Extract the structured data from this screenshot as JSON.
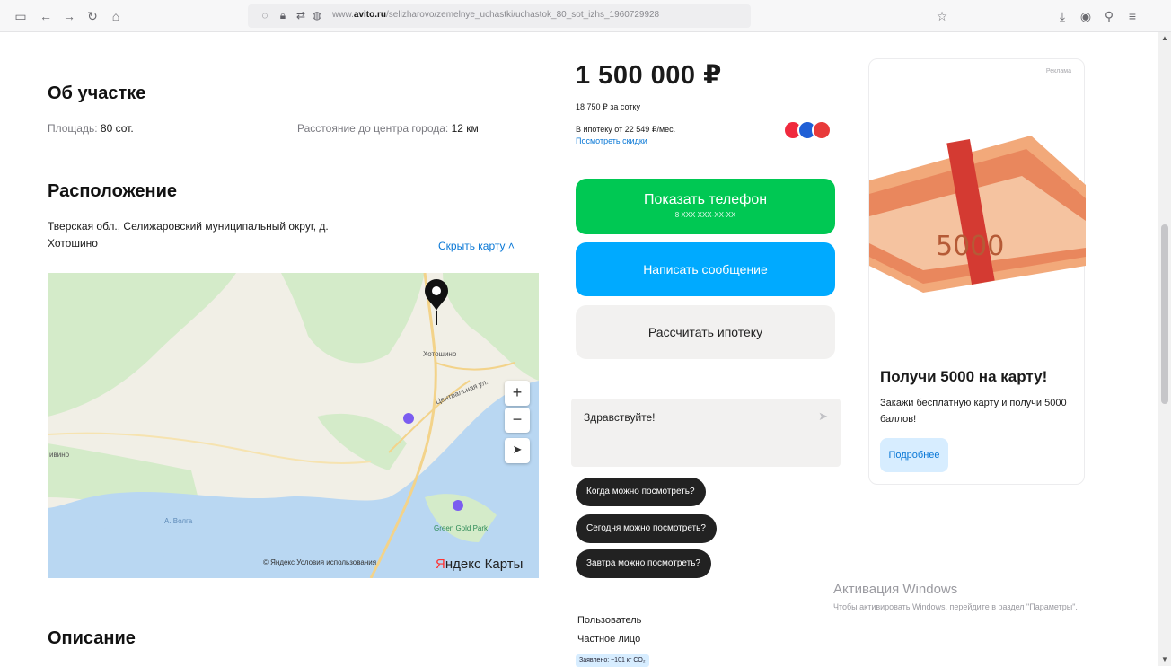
{
  "browser": {
    "url_domain": "avito.ru",
    "url_prefix": "www.",
    "url_path": "/selizharovo/zemelnye_uchastki/uchastok_80_sot_izhs_1960729928"
  },
  "about": {
    "heading": "Об участке",
    "area_label": "Площадь:",
    "area_value": "80 сот.",
    "distance_label": "Расстояние до центра города:",
    "distance_value": "12 км"
  },
  "location": {
    "heading": "Расположение",
    "address": "Тверская обл., Селижаровский муниципальный округ, д.",
    "address_line2": "Хотошино",
    "hide_map": "Скрыть карту ˄"
  },
  "map": {
    "village_label": "Хотошино",
    "street_label": "Центральная ул.",
    "left_label": "ивино",
    "park_label": "Green Gold Park",
    "water_label": "А. Волга",
    "zoom_in": "+",
    "zoom_out": "−",
    "locate": "➤",
    "copyright": "© Яндекс",
    "terms": "Условия использования",
    "brand_red": "Я",
    "brand_rest": "ндекс Карты"
  },
  "pricing": {
    "price": "1 500 000 ₽",
    "per_sotka": "18 750 ₽ за сотку",
    "mortgage": "В ипотеку от 22 549 ₽/мес.",
    "discounts": "Посмотреть скидки"
  },
  "actions": {
    "show_phone": "Показать телефон",
    "phone_mask": "8 XXX XXX-XX-XX",
    "write_message": "Написать сообщение",
    "calc_mortgage": "Рассчитать ипотеку"
  },
  "chat": {
    "placeholder": "Здравствуйте!",
    "send_icon": "➤",
    "quick_replies": [
      "Когда можно посмотреть?",
      "Сегодня можно посмотреть?",
      "Завтра можно посмотреть?"
    ]
  },
  "seller": {
    "name": "Пользователь",
    "type": "Частное лицо",
    "badge": "Заявлено: ~101 кг CO₂"
  },
  "description": {
    "heading": "Описание"
  },
  "ad": {
    "tag": "Реклама",
    "title": "Получи 5000 на карту!",
    "desc": "Закажи бесплатную карту и получи 5000 баллов!",
    "button": "Подробнее",
    "banknote": "5000"
  },
  "watermark": {
    "line1": "Активация Windows",
    "line2": "Чтобы активировать Windows, перейдите в раздел \"Параметры\"."
  },
  "colors": {
    "green": "#00c853",
    "blue": "#00aaff",
    "link": "#0a78d6"
  }
}
